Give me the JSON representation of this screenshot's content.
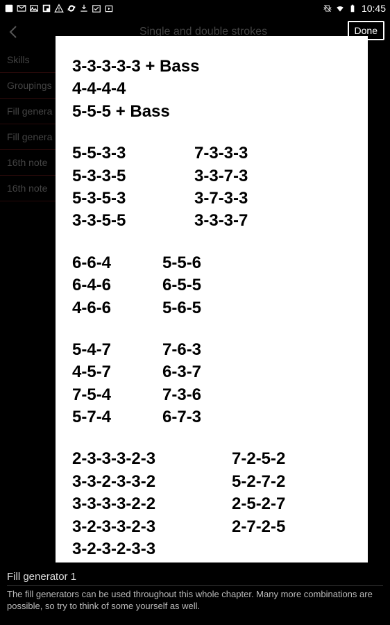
{
  "status": {
    "time": "10:45"
  },
  "header": {
    "title": "Single and double strokes",
    "done": "Done"
  },
  "sidebar": {
    "items": [
      {
        "label": "Skills"
      },
      {
        "label": "Groupings"
      },
      {
        "label": "Fill genera"
      },
      {
        "label": "Fill genera"
      },
      {
        "label": "16th note"
      },
      {
        "label": "16th note"
      }
    ]
  },
  "sheet": {
    "block1": [
      "3-3-3-3-3 + Bass",
      "4-4-4-4",
      "5-5-5 + Bass"
    ],
    "block2": {
      "colA": [
        "5-5-3-3",
        "5-3-3-5",
        "5-3-5-3",
        "3-3-5-5"
      ],
      "colB": [
        "7-3-3-3",
        "3-3-7-3",
        "3-7-3-3",
        "3-3-3-7"
      ]
    },
    "block3": {
      "colA": [
        "6-6-4",
        "6-4-6",
        "4-6-6"
      ],
      "colB": [
        "5-5-6",
        "6-5-5",
        "5-6-5"
      ]
    },
    "block4": {
      "colA": [
        "5-4-7",
        "4-5-7",
        "7-5-4",
        "5-7-4"
      ],
      "colB": [
        "7-6-3",
        "6-3-7",
        "7-3-6",
        "6-7-3"
      ]
    },
    "block5": {
      "colA": [
        "2-3-3-3-2-3",
        "3-3-2-3-3-2",
        "3-3-3-3-2-2",
        "3-2-3-3-2-3",
        "3-2-3-2-3-3"
      ],
      "colB": [
        "7-2-5-2",
        "5-2-7-2",
        "2-5-2-7",
        "2-7-2-5"
      ]
    }
  },
  "footer": {
    "title": "Fill generator 1",
    "body": "The fill generators can be used throughout this whole chapter. Many more combinations are possible, so try to think of some yourself as well."
  }
}
